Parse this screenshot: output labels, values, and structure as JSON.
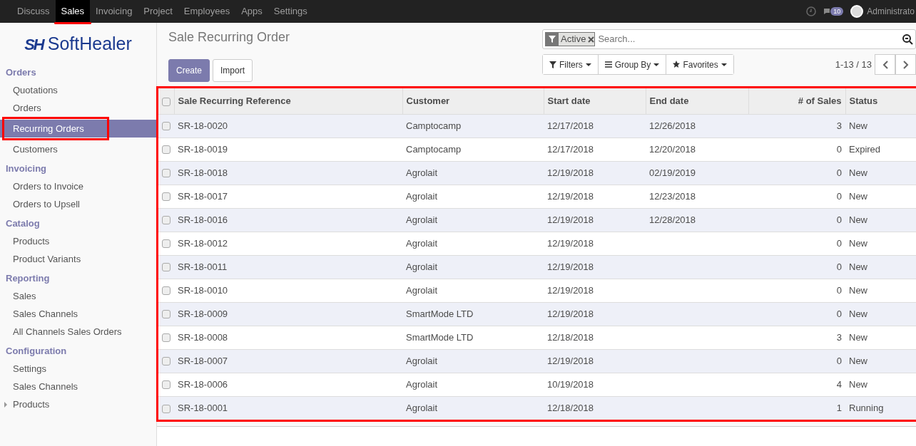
{
  "topbar": {
    "apps": [
      {
        "label": "Discuss",
        "selected": false
      },
      {
        "label": "Sales",
        "selected": true,
        "highlighted": true
      },
      {
        "label": "Invoicing",
        "selected": false
      },
      {
        "label": "Project",
        "selected": false
      },
      {
        "label": "Employees",
        "selected": false
      },
      {
        "label": "Apps",
        "selected": false
      },
      {
        "label": "Settings",
        "selected": false
      }
    ],
    "messages_count": "10",
    "user": "Administrato"
  },
  "logo": {
    "mark": "SH",
    "name": "SoftHealer"
  },
  "sidebar": {
    "sections": [
      {
        "title": "Orders",
        "items": [
          {
            "label": "Quotations",
            "selected": false
          },
          {
            "label": "Orders",
            "selected": false
          },
          {
            "label": "Recurring Orders",
            "selected": true,
            "highlighted": true
          },
          {
            "label": "Customers",
            "selected": false
          }
        ]
      },
      {
        "title": "Invoicing",
        "items": [
          {
            "label": "Orders to Invoice",
            "selected": false
          },
          {
            "label": "Orders to Upsell",
            "selected": false
          }
        ]
      },
      {
        "title": "Catalog",
        "items": [
          {
            "label": "Products",
            "selected": false
          },
          {
            "label": "Product Variants",
            "selected": false
          }
        ]
      },
      {
        "title": "Reporting",
        "items": [
          {
            "label": "Sales",
            "selected": false
          },
          {
            "label": "Sales Channels",
            "selected": false
          },
          {
            "label": "All Channels Sales Orders",
            "selected": false
          }
        ]
      },
      {
        "title": "Configuration",
        "items": [
          {
            "label": "Settings",
            "selected": false
          },
          {
            "label": "Sales Channels",
            "selected": false
          },
          {
            "label": "Products",
            "selected": false,
            "expandable": true
          }
        ]
      }
    ]
  },
  "page_title": "Sale Recurring Order",
  "buttons": [
    {
      "label": "Create",
      "kind": "primary"
    },
    {
      "label": "Import",
      "kind": "secondary"
    }
  ],
  "search": {
    "facet": "Active",
    "placeholder": "Search..."
  },
  "search_options": [
    "Filters",
    "Group By",
    "Favorites"
  ],
  "pager": "1-13 / 13",
  "table": {
    "highlighted": true,
    "all_checked": false,
    "columns": [
      "Sale Recurring Reference",
      "Customer",
      "Start date",
      "End date",
      "# of Sales",
      "Status"
    ],
    "rows": [
      {
        "checked": false,
        "cells": [
          "SR-18-0020",
          "Camptocamp",
          "12/17/2018",
          "12/26/2018",
          "3",
          "New"
        ]
      },
      {
        "checked": false,
        "cells": [
          "SR-18-0019",
          "Camptocamp",
          "12/17/2018",
          "12/20/2018",
          "0",
          "Expired"
        ]
      },
      {
        "checked": false,
        "cells": [
          "SR-18-0018",
          "Agrolait",
          "12/19/2018",
          "02/19/2019",
          "0",
          "New"
        ]
      },
      {
        "checked": false,
        "cells": [
          "SR-18-0017",
          "Agrolait",
          "12/19/2018",
          "12/23/2018",
          "0",
          "New"
        ]
      },
      {
        "checked": false,
        "cells": [
          "SR-18-0016",
          "Agrolait",
          "12/19/2018",
          "12/28/2018",
          "0",
          "New"
        ]
      },
      {
        "checked": false,
        "cells": [
          "SR-18-0012",
          "Agrolait",
          "12/19/2018",
          "",
          "0",
          "New"
        ]
      },
      {
        "checked": false,
        "cells": [
          "SR-18-0011",
          "Agrolait",
          "12/19/2018",
          "",
          "0",
          "New"
        ]
      },
      {
        "checked": false,
        "cells": [
          "SR-18-0010",
          "Agrolait",
          "12/19/2018",
          "",
          "0",
          "New"
        ]
      },
      {
        "checked": false,
        "cells": [
          "SR-18-0009",
          "SmartMode LTD",
          "12/19/2018",
          "",
          "0",
          "New"
        ]
      },
      {
        "checked": false,
        "cells": [
          "SR-18-0008",
          "SmartMode LTD",
          "12/18/2018",
          "",
          "3",
          "New"
        ]
      },
      {
        "checked": false,
        "cells": [
          "SR-18-0007",
          "Agrolait",
          "12/19/2018",
          "",
          "0",
          "New"
        ]
      },
      {
        "checked": false,
        "cells": [
          "SR-18-0006",
          "Agrolait",
          "10/19/2018",
          "",
          "4",
          "New"
        ]
      },
      {
        "checked": false,
        "cells": [
          "SR-18-0001",
          "Agrolait",
          "12/18/2018",
          "",
          "1",
          "Running"
        ]
      }
    ]
  }
}
